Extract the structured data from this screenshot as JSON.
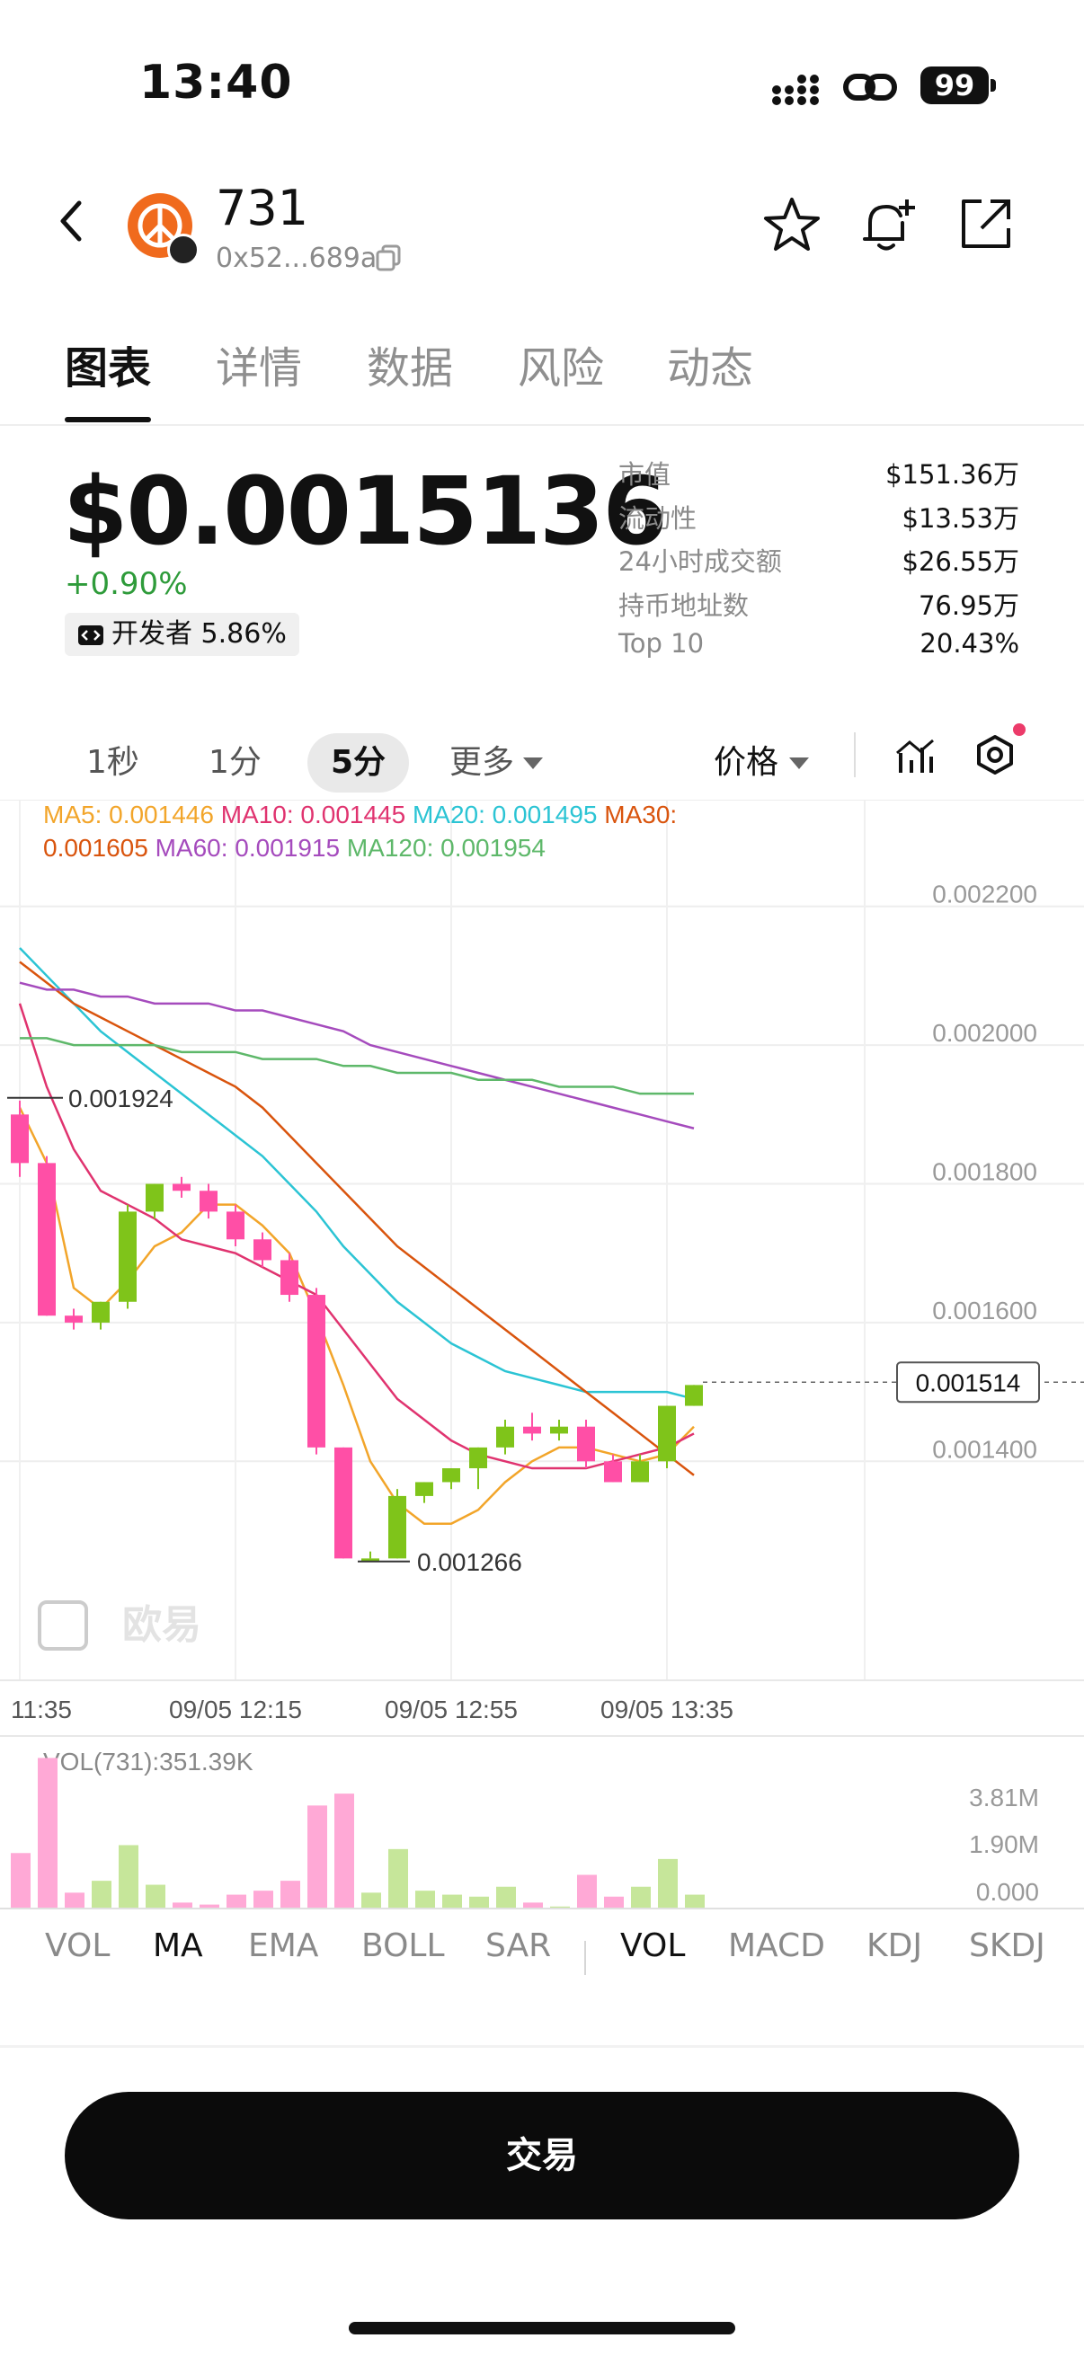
{
  "status_bar": {
    "time": "13:40",
    "battery": "99"
  },
  "header": {
    "token_name": "731",
    "address": "0x52...689a"
  },
  "tabs": [
    "图表",
    "详情",
    "数据",
    "风险",
    "动态"
  ],
  "price": {
    "value": "$0.0015136",
    "change": "+0.90%",
    "dev_badge": "开发者 5.86%"
  },
  "stats": [
    {
      "label": "市值",
      "value": "$151.36万"
    },
    {
      "label": "流动性",
      "value": "$13.53万"
    },
    {
      "label": "24小时成交额",
      "value": "$26.55万"
    },
    {
      "label": "持币地址数",
      "value": "76.95万"
    },
    {
      "label": "Top 10",
      "value": "20.43%"
    }
  ],
  "timeframes": [
    "1秒",
    "1分",
    "5分",
    "更多"
  ],
  "timeframe_active": "5分",
  "price_menu": "价格",
  "colors": {
    "up": "#7fc41a",
    "down": "#ff4fa6",
    "ma5": "#f2a52a",
    "ma10": "#e0336f",
    "ma20": "#2bc4d4",
    "ma30": "#d9540d",
    "ma60": "#a54bbd",
    "ma120": "#5eb86a"
  },
  "chart_data": {
    "type": "candlestick",
    "ma_legend": [
      {
        "label": "MA5: 0.001446",
        "color": "#f2a52a"
      },
      {
        "label": "MA10: 0.001445",
        "color": "#e0336f"
      },
      {
        "label": "MA20: 0.001495",
        "color": "#2bc4d4"
      },
      {
        "label": "MA30:",
        "color": "#d9540d"
      },
      {
        "label": "0.001605",
        "color": "#d9540d"
      },
      {
        "label": "MA60: 0.001915",
        "color": "#a54bbd"
      },
      {
        "label": "MA120: 0.001954",
        "color": "#5eb86a"
      }
    ],
    "y_ticks": [
      "0.002200",
      "0.002000",
      "0.001800",
      "0.001600",
      "0.001400"
    ],
    "y_tick_values": [
      0.0022,
      0.002,
      0.0018,
      0.0016,
      0.0014
    ],
    "ylim": [
      0.001175,
      0.002302
    ],
    "x_ticks": [
      "11:35",
      "09/05 12:15",
      "09/05 12:55",
      "09/05 13:35"
    ],
    "x_tick_index": [
      0,
      8,
      16,
      24
    ],
    "high_label": "0.001924",
    "low_label": "0.001266",
    "current_label": "0.001514",
    "current_value": 0.001514,
    "candles": [
      {
        "o": 0.0019,
        "h": 0.00192,
        "c": 0.00183,
        "l": 0.00181
      },
      {
        "o": 0.00183,
        "h": 0.00184,
        "c": 0.00161,
        "l": 0.00161
      },
      {
        "o": 0.00161,
        "h": 0.00162,
        "c": 0.0016,
        "l": 0.00159
      },
      {
        "o": 0.0016,
        "h": 0.00163,
        "c": 0.00163,
        "l": 0.00159
      },
      {
        "o": 0.00163,
        "h": 0.00177,
        "c": 0.00176,
        "l": 0.00162
      },
      {
        "o": 0.00176,
        "h": 0.0018,
        "c": 0.0018,
        "l": 0.00175
      },
      {
        "o": 0.0018,
        "h": 0.00181,
        "c": 0.00179,
        "l": 0.00178
      },
      {
        "o": 0.00179,
        "h": 0.0018,
        "c": 0.00176,
        "l": 0.00175
      },
      {
        "o": 0.00176,
        "h": 0.00177,
        "c": 0.00172,
        "l": 0.00171
      },
      {
        "o": 0.00172,
        "h": 0.00173,
        "c": 0.00169,
        "l": 0.00168
      },
      {
        "o": 0.00169,
        "h": 0.0017,
        "c": 0.00164,
        "l": 0.00163
      },
      {
        "o": 0.00164,
        "h": 0.00165,
        "c": 0.00142,
        "l": 0.00141
      },
      {
        "o": 0.00142,
        "h": 0.00142,
        "c": 0.00126,
        "l": 0.00126
      },
      {
        "o": 0.00126,
        "h": 0.00127,
        "c": 0.00126,
        "l": 0.00126
      },
      {
        "o": 0.00126,
        "h": 0.00136,
        "c": 0.00135,
        "l": 0.00126
      },
      {
        "o": 0.00135,
        "h": 0.00137,
        "c": 0.00137,
        "l": 0.00134
      },
      {
        "o": 0.00137,
        "h": 0.00139,
        "c": 0.00139,
        "l": 0.00136
      },
      {
        "o": 0.00139,
        "h": 0.00142,
        "c": 0.00142,
        "l": 0.00136
      },
      {
        "o": 0.00142,
        "h": 0.00146,
        "c": 0.00145,
        "l": 0.00141
      },
      {
        "o": 0.00145,
        "h": 0.00147,
        "c": 0.00144,
        "l": 0.00143
      },
      {
        "o": 0.00144,
        "h": 0.00146,
        "c": 0.00145,
        "l": 0.00143
      },
      {
        "o": 0.00145,
        "h": 0.00146,
        "c": 0.0014,
        "l": 0.00139
      },
      {
        "o": 0.0014,
        "h": 0.00141,
        "c": 0.00137,
        "l": 0.00137
      },
      {
        "o": 0.00137,
        "h": 0.00141,
        "c": 0.0014,
        "l": 0.00137
      },
      {
        "o": 0.0014,
        "h": 0.00148,
        "c": 0.00148,
        "l": 0.00139
      },
      {
        "o": 0.00148,
        "h": 0.00151,
        "c": 0.00151,
        "l": 0.00148
      }
    ],
    "ma": [
      {
        "name": "MA5",
        "color": "#f2a52a",
        "start": 0,
        "values": [
          0.00191,
          0.00183,
          0.00165,
          0.00162,
          0.00166,
          0.00171,
          0.00173,
          0.00177,
          0.00177,
          0.00174,
          0.0017,
          0.00161,
          0.00151,
          0.0014,
          0.00134,
          0.00131,
          0.00131,
          0.00133,
          0.00137,
          0.0014,
          0.00142,
          0.00142,
          0.00141,
          0.0014,
          0.00141,
          0.00145
        ]
      },
      {
        "name": "MA10",
        "color": "#e0336f",
        "start": 0,
        "values": [
          0.00206,
          0.00194,
          0.00185,
          0.00179,
          0.00177,
          0.00175,
          0.00172,
          0.00171,
          0.0017,
          0.00168,
          0.00166,
          0.00164,
          0.00159,
          0.00154,
          0.00149,
          0.00146,
          0.00143,
          0.00141,
          0.0014,
          0.00139,
          0.00139,
          0.00139,
          0.0014,
          0.00141,
          0.00142,
          0.00144
        ]
      },
      {
        "name": "MA20",
        "color": "#2bc4d4",
        "start": 0,
        "values": [
          0.00214,
          0.0021,
          0.00206,
          0.00202,
          0.00199,
          0.00196,
          0.00193,
          0.0019,
          0.00187,
          0.00184,
          0.0018,
          0.00176,
          0.00171,
          0.00167,
          0.00163,
          0.0016,
          0.00157,
          0.00155,
          0.00153,
          0.00152,
          0.00151,
          0.0015,
          0.0015,
          0.0015,
          0.0015,
          0.00149
        ]
      },
      {
        "name": "MA30",
        "color": "#d9540d",
        "start": 0,
        "values": [
          0.00212,
          0.00209,
          0.00206,
          0.00204,
          0.00202,
          0.002,
          0.00198,
          0.00196,
          0.00194,
          0.00191,
          0.00187,
          0.00183,
          0.00179,
          0.00175,
          0.00171,
          0.00168,
          0.00165,
          0.00162,
          0.00159,
          0.00156,
          0.00153,
          0.0015,
          0.00147,
          0.00144,
          0.00141,
          0.00138
        ]
      },
      {
        "name": "MA60",
        "color": "#a54bbd",
        "start": 0,
        "values": [
          0.00209,
          0.00208,
          0.00208,
          0.00207,
          0.00207,
          0.00206,
          0.00206,
          0.00206,
          0.00205,
          0.00205,
          0.00204,
          0.00203,
          0.00202,
          0.002,
          0.00199,
          0.00198,
          0.00197,
          0.00196,
          0.00195,
          0.00194,
          0.00193,
          0.00192,
          0.00191,
          0.0019,
          0.00189,
          0.00188
        ]
      },
      {
        "name": "MA120",
        "color": "#5eb86a",
        "start": 0,
        "values": [
          0.00201,
          0.00201,
          0.002,
          0.002,
          0.002,
          0.002,
          0.00199,
          0.00199,
          0.00199,
          0.00198,
          0.00198,
          0.00198,
          0.00197,
          0.00197,
          0.00196,
          0.00196,
          0.00196,
          0.00195,
          0.00195,
          0.00195,
          0.00194,
          0.00194,
          0.00194,
          0.00193,
          0.00193,
          0.00193
        ]
      }
    ],
    "volume": {
      "label": "VOL(731):351.39K",
      "y_ticks": [
        "3.81M",
        "1.90M",
        "0.000"
      ],
      "max": 3.81,
      "values_m": [
        1.4,
        3.8,
        0.4,
        0.7,
        1.6,
        0.6,
        0.15,
        0.1,
        0.35,
        0.45,
        0.7,
        2.6,
        2.9,
        0.4,
        1.5,
        0.45,
        0.35,
        0.3,
        0.55,
        0.15,
        0.05,
        0.85,
        0.3,
        0.55,
        1.25,
        0.35
      ]
    }
  },
  "indicator_tabs": [
    "VOL",
    "MA",
    "EMA",
    "BOLL",
    "SAR",
    "VOL",
    "MACD",
    "KDJ",
    "SKDJ"
  ],
  "trade_button": "交易",
  "watermark": "欧易"
}
